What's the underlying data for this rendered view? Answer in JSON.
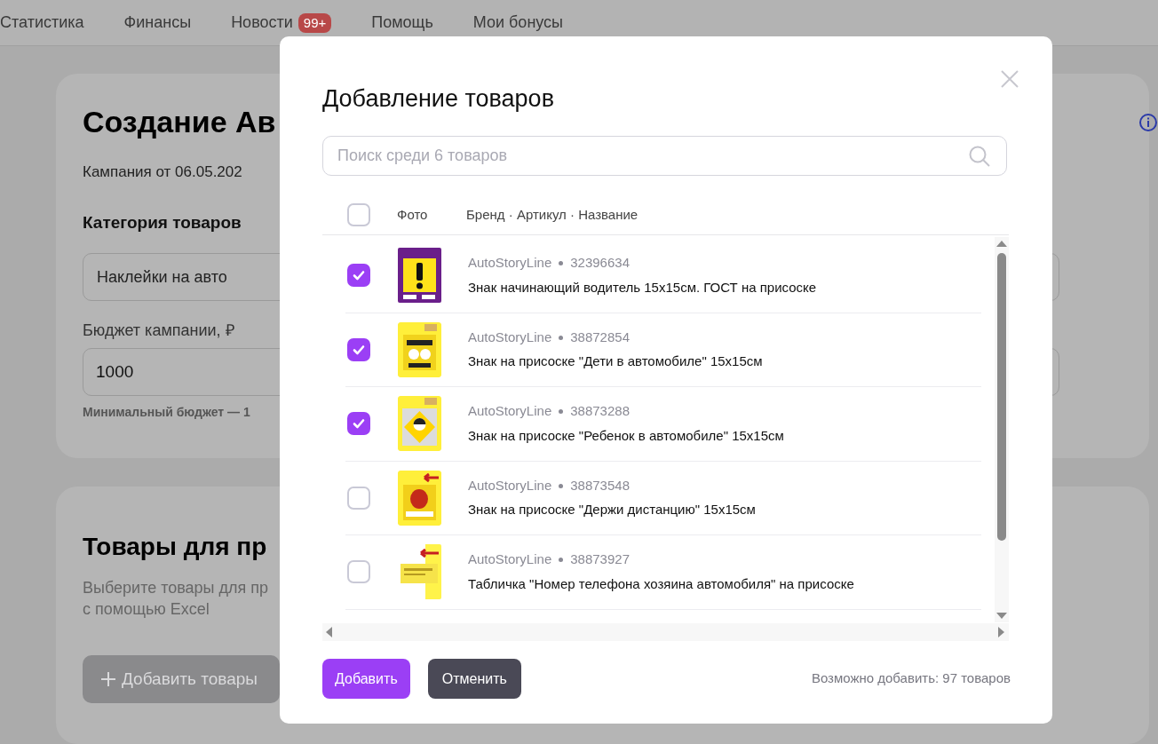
{
  "nav": [
    {
      "label": "Статистика"
    },
    {
      "label": "Финансы"
    },
    {
      "label": "Новости",
      "badge": "99+"
    },
    {
      "label": "Помощь"
    },
    {
      "label": "Мои бонусы"
    }
  ],
  "campaign_card": {
    "title": "Создание Ав",
    "subtitle": "Кампания от 06.05.202",
    "category_label": "Категория товаров",
    "category_value": "Наклейки на авто",
    "budget_label": "Бюджет кампании, ₽",
    "budget_value": "1000",
    "budget_hint": "Минимальный бюджет — 1"
  },
  "products_card": {
    "title": "Товары для пр",
    "description": [
      "Выберите товары для пр",
      "с помощью Excel"
    ],
    "add_button": "Добавить товары"
  },
  "modal": {
    "title": "Добавление товаров",
    "search": {
      "placeholder": "Поиск среди 6 товаров"
    },
    "select_all": {
      "checked": false
    },
    "columns": [
      "Фото",
      "Бренд · Артикул · Название"
    ],
    "rows": [
      {
        "brand": "AutoStoryLine",
        "article": "32396634",
        "name": "Знак начинающий водитель 15х15см. ГОСТ на присоске",
        "checked": true
      },
      {
        "brand": "AutoStoryLine",
        "article": "38872854",
        "name": "Знак на присоске \"Дети в автомобиле\" 15х15см",
        "checked": true
      },
      {
        "brand": "AutoStoryLine",
        "article": "38873288",
        "name": "Знак на присоске \"Ребенок в автомобиле\" 15х15см",
        "checked": true
      },
      {
        "brand": "AutoStoryLine",
        "article": "38873548",
        "name": "Знак на присоске \"Держи дистанцию\" 15х15см",
        "checked": false
      },
      {
        "brand": "AutoStoryLine",
        "article": "38873927",
        "name": "Табличка \"Номер телефона хозяина автомобиля\" на присоске",
        "checked": false
      }
    ],
    "add_button": "Добавить",
    "cancel_button": "Отменить",
    "limit_text": "Возможно добавить: 97 товаров"
  }
}
